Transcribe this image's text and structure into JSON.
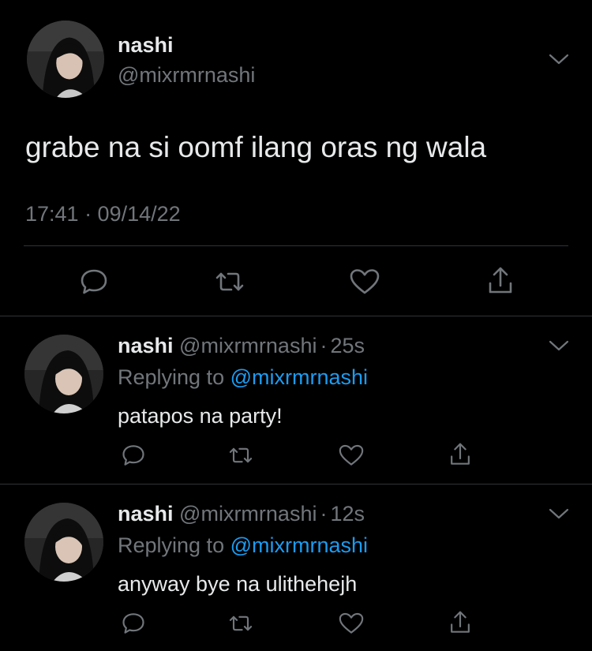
{
  "main_tweet": {
    "display_name": "nashi",
    "handle": "@mixrmrnashi",
    "text": "grabe na si oomf ilang oras ng wala",
    "timestamp": "17:41 · 09/14/22",
    "icons": {
      "menu": "chevron-down-icon",
      "actions": [
        "reply-icon",
        "retweet-icon",
        "like-icon",
        "share-icon"
      ]
    }
  },
  "replies": [
    {
      "display_name": "nashi",
      "handle": "@mixrmrnashi",
      "separator": "·",
      "time_ago": "25s",
      "replying_prefix": "Replying to",
      "replying_to": "@mixrmrnashi",
      "text": "patapos na party!"
    },
    {
      "display_name": "nashi",
      "handle": "@mixrmrnashi",
      "separator": "·",
      "time_ago": "12s",
      "replying_prefix": "Replying to",
      "replying_to": "@mixrmrnashi",
      "text": "anyway bye na ulithehejh"
    }
  ],
  "colors": {
    "background": "#000000",
    "text": "#e7e9ea",
    "secondary": "#71767b",
    "link": "#1d9bf0",
    "divider": "#2f3336"
  }
}
